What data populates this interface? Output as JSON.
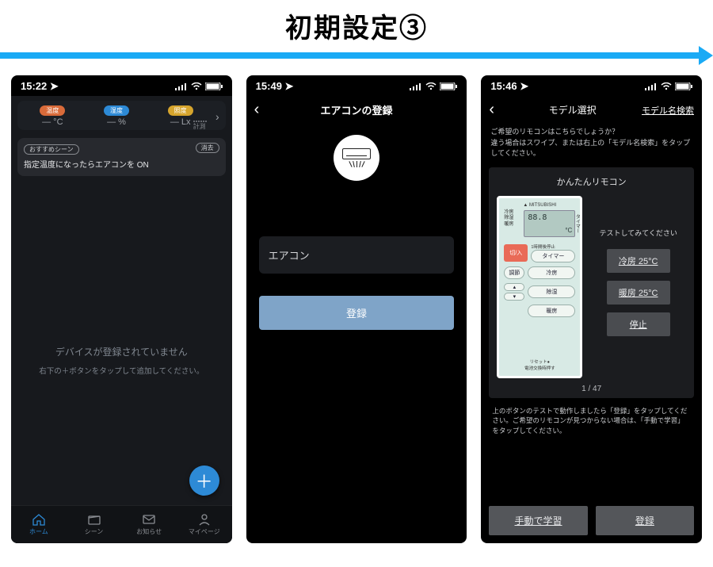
{
  "page_title": "初期設定③",
  "phone1": {
    "time": "15:22",
    "sensors": {
      "temp_label": "温度",
      "temp_val": "— °C",
      "hum_label": "湿度",
      "hum_val": "— %",
      "lux_label": "照度",
      "lux_val": "— Lx",
      "footer": "計測"
    },
    "scene": {
      "rec": "おすすめシーン",
      "dismiss": "消去",
      "text": "指定温度になったらエアコンを ON"
    },
    "empty1": "デバイスが登録されていません",
    "empty2": "右下の＋ボタンをタップして追加してください。",
    "tabs": [
      "ホーム",
      "シーン",
      "お知らせ",
      "マイページ"
    ]
  },
  "phone2": {
    "time": "15:49",
    "title": "エアコンの登録",
    "field_value": "エアコン",
    "register": "登録"
  },
  "phone3": {
    "time": "15:46",
    "title": "モデル選択",
    "search": "モデル名検索",
    "hint": "ご希望のリモコンはこちらでしょうか？\n違う場合はスワイプ、または右上の「モデル名検索」をタップしてください。",
    "card_title": "かんたんリモコン",
    "remote": {
      "brand": "▲ MITSUBISHI",
      "mode_labels": "冷房\n除湿\n暖房",
      "lcd_num": "88.8",
      "lcd_c": "°C",
      "side": "タイマー",
      "onoff": "切/入",
      "timer_sub": "1時間後停止",
      "timer_btn": "タイマー",
      "adjust": "調節",
      "cool": "冷房",
      "dry": "除湿",
      "heat": "暖房",
      "reset": "リセット●\n電池交換時押す"
    },
    "test_label": "テストしてみてください",
    "tests": [
      "冷房 25°C",
      "暖房 25°C",
      "停止"
    ],
    "pager": "1 / 47",
    "foot_hint": "上のボタンのテストで動作しましたら「登録」をタップしてください。ご希望のリモコンが見つからない場合は、「手動で学習」をタップしてください。",
    "manual": "手動で学習",
    "register": "登録"
  }
}
